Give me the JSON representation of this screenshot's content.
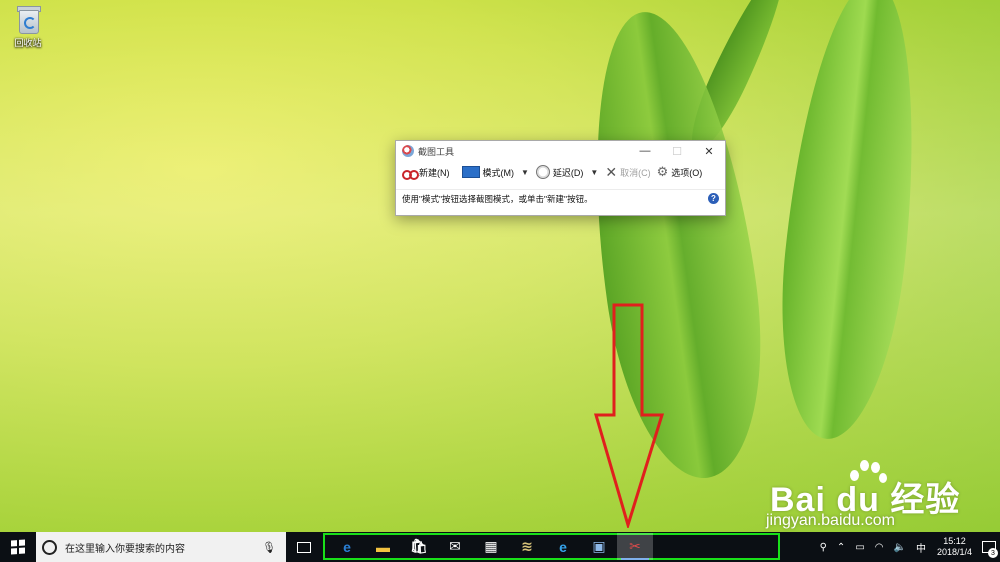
{
  "desktop": {
    "icons": [
      {
        "label": "回收站",
        "icon": "recycle-bin-icon"
      }
    ]
  },
  "snipping_tool": {
    "title": "截图工具",
    "controls": {
      "minimize": "—",
      "maximize": "☐",
      "close": "✕"
    },
    "toolbar": {
      "new_label": "新建(N)",
      "mode_label": "模式(M)",
      "delay_label": "延迟(D)",
      "cancel_label": "取消(C)",
      "options_label": "选项(O)"
    },
    "status_text": "使用\"模式\"按钮选择截图模式，或单击\"新建\"按钮。",
    "help": "?"
  },
  "watermark": {
    "brand": "Bai du 经验",
    "url": "jingyan.baidu.com"
  },
  "taskbar": {
    "search_placeholder": "在这里输入你要搜索的内容",
    "pinned_apps": [
      {
        "name": "edge",
        "icon": "edge-icon",
        "glyph": "e",
        "color": "#2a7fd4"
      },
      {
        "name": "file-explorer",
        "icon": "folder-icon",
        "glyph": "▬",
        "color": "#f3c340"
      },
      {
        "name": "store",
        "icon": "store-icon",
        "glyph": "🛍",
        "color": "#ffffff"
      },
      {
        "name": "mail",
        "icon": "mail-icon",
        "glyph": "✉",
        "color": "#ffffff"
      },
      {
        "name": "calculator",
        "icon": "calculator-icon",
        "glyph": "▦",
        "color": "#ffffff"
      },
      {
        "name": "app",
        "icon": "books-icon",
        "glyph": "≋",
        "color": "#d8c37a"
      },
      {
        "name": "internet-explorer",
        "icon": "ie-icon",
        "glyph": "e",
        "color": "#35a3ea"
      },
      {
        "name": "remote-desktop",
        "icon": "monitor-icon",
        "glyph": "▣",
        "color": "#8db8e8"
      },
      {
        "name": "snipping-tool",
        "icon": "scissors-icon",
        "glyph": "✂",
        "color": "#e14b4b",
        "active": true
      }
    ],
    "tray": {
      "input_method": "中",
      "time": "15:12",
      "date": "2018/1/4",
      "notification_count": "3"
    }
  }
}
